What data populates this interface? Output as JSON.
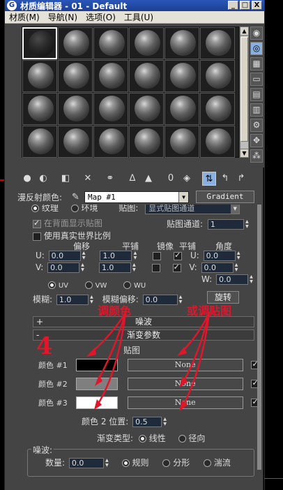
{
  "window": {
    "title": "材质编辑器 - 01 - Default",
    "icon_glyph": "G",
    "buttons": {
      "minimize": "_",
      "maximize": "□",
      "close": "X"
    }
  },
  "menu": [
    "材质(M)",
    "导航(N)",
    "选项(O)",
    "工具(U)"
  ],
  "slots": {
    "rows": 4,
    "cols": 6,
    "active_index": 0
  },
  "diffuse": {
    "label": "漫反射颜色:",
    "map_name": "Map #1",
    "type_button": "Gradient"
  },
  "coordinates": {
    "texture_label": "纹理",
    "env_label": "环境",
    "mapping_label": "贴图:",
    "mapping_value": "显式贴图通道",
    "show_back": "在背面显示贴图",
    "channel_label": "贴图通道:",
    "channel_value": "1",
    "real_world": "使用真实世界比例",
    "headers": {
      "offset": "偏移",
      "tiling": "平铺",
      "mirror": "镜像",
      "tile": "平铺",
      "angle": "角度"
    },
    "rows": [
      {
        "axis": "U:",
        "offset": "0.0",
        "tiling": "1.0",
        "angle_axis": "U:",
        "angle": "0.0"
      },
      {
        "axis": "V:",
        "offset": "0.0",
        "tiling": "1.0",
        "angle_axis": "V:",
        "angle": "0.0"
      },
      {
        "angle_axis": "W:",
        "angle": "0.0"
      }
    ],
    "uv_options": [
      "UV",
      "VW",
      "WU"
    ],
    "blur_label": "模糊:",
    "blur_value": "1.0",
    "blur_offset_label": "模糊偏移:",
    "blur_offset_value": "0.0",
    "rotate_button": "旋转"
  },
  "rollouts": {
    "noise": {
      "sign": "+",
      "title": "噪波"
    },
    "gradient": {
      "sign": "-",
      "title": "渐变参数"
    }
  },
  "gradient": {
    "maps_header": "贴图",
    "colors": [
      {
        "label": "颜色 #1",
        "swatch": "#000000",
        "map": "None"
      },
      {
        "label": "颜色 #2",
        "swatch": "#7f7f7f",
        "map": "None"
      },
      {
        "label": "颜色 #3",
        "swatch": "#ffffff",
        "map": "None"
      }
    ],
    "position_label": "颜色 2 位置:",
    "position_value": "0.5",
    "type_label": "渐变类型:",
    "type_options": [
      "线性",
      "径向"
    ]
  },
  "noise": {
    "group_label": "噪波:",
    "amount_label": "数量:",
    "amount_value": "0.0",
    "type_options": [
      "规则",
      "分形",
      "湍流"
    ]
  },
  "annotations": {
    "step_number": "4",
    "adjust_color": "调颜色",
    "adjust_map": "或调贴图",
    "color": "#e0162b"
  }
}
